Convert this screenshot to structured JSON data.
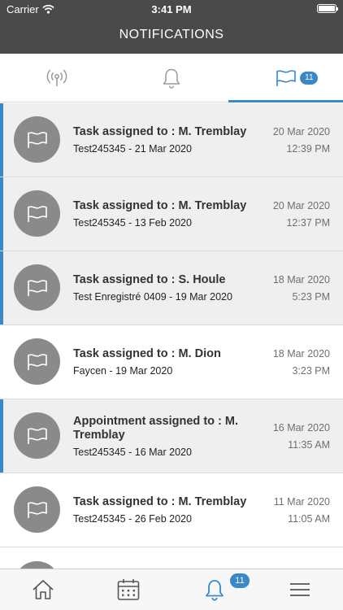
{
  "status_bar": {
    "carrier": "Carrier",
    "time": "3:41 PM"
  },
  "header": {
    "title": "NOTIFICATIONS"
  },
  "tabs": [
    {
      "icon": "broadcast-icon"
    },
    {
      "icon": "bell-icon"
    },
    {
      "icon": "flag-icon",
      "badge": "11",
      "active": true
    }
  ],
  "notifications": [
    {
      "title": "Task assigned to : M. Tremblay",
      "subtitle": "Test245345 - 21 Mar 2020",
      "date": "20 Mar 2020",
      "time": "12:39 PM",
      "unread": true
    },
    {
      "title": "Task assigned to : M. Tremblay",
      "subtitle": "Test245345 - 13 Feb 2020",
      "date": "20 Mar 2020",
      "time": "12:37 PM",
      "unread": true
    },
    {
      "title": "Task assigned to : S. Houle",
      "subtitle": "Test Enregistré 0409 - 19 Mar 2020",
      "date": "18 Mar 2020",
      "time": "5:23 PM",
      "unread": true
    },
    {
      "title": "Task assigned to : M. Dion",
      "subtitle": "Faycen - 19 Mar 2020",
      "date": "18 Mar 2020",
      "time": "3:23 PM",
      "unread": false
    },
    {
      "title": "Appointment assigned to : M. Tremblay",
      "subtitle": "Test245345 - 16 Mar 2020",
      "date": "16 Mar 2020",
      "time": "11:35 AM",
      "unread": true
    },
    {
      "title": "Task assigned to : M. Tremblay",
      "subtitle": "Test245345 - 26 Feb 2020",
      "date": "11 Mar 2020",
      "time": "11:05 AM",
      "unread": false
    }
  ],
  "bottom_nav": [
    {
      "icon": "home-icon"
    },
    {
      "icon": "calendar-icon"
    },
    {
      "icon": "bell-icon",
      "badge": "11",
      "active": true
    },
    {
      "icon": "menu-icon"
    }
  ],
  "colors": {
    "header": "#4a4a4a",
    "accent": "#3a88c6",
    "unread_bg": "#efefef",
    "avatar": "#8a8a8a"
  }
}
